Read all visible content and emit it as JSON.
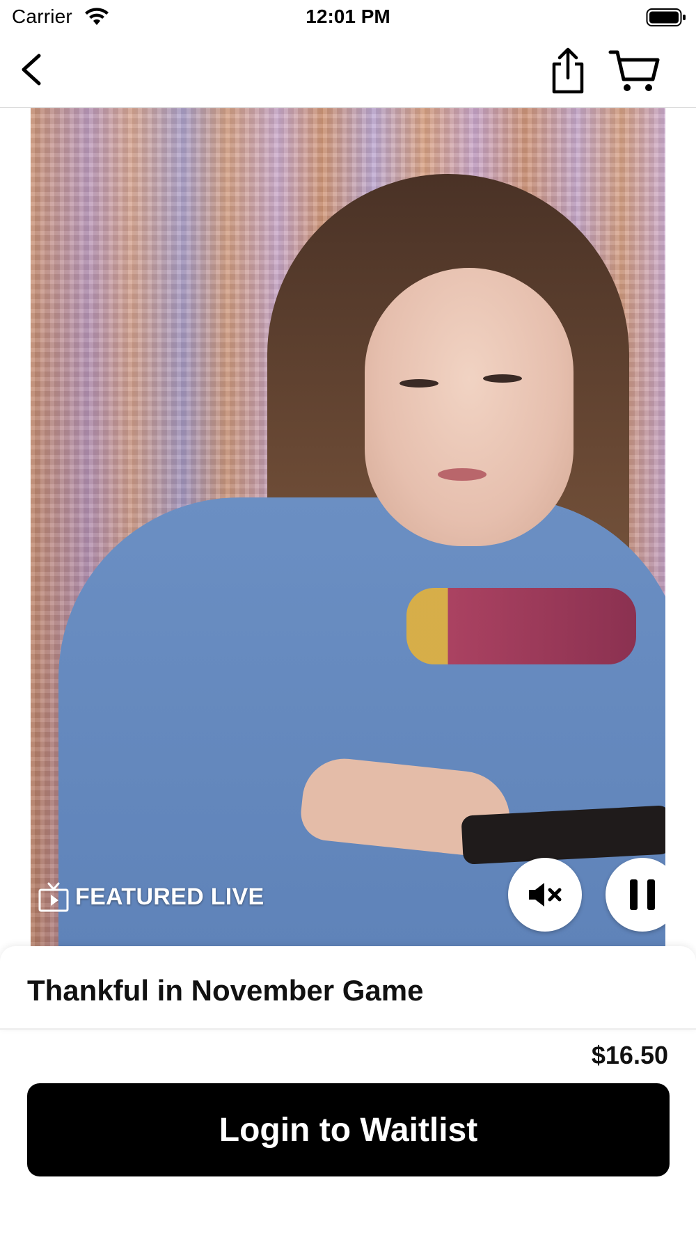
{
  "status_bar": {
    "carrier": "Carrier",
    "time": "12:01 PM",
    "icons": [
      "wifi-icon",
      "battery-icon"
    ]
  },
  "nav": {
    "icons": [
      "chevron-left-icon",
      "share-icon",
      "cart-icon"
    ]
  },
  "video": {
    "badge_label": "FEATURED LIVE",
    "badge_icon": "tv-play-icon",
    "controls": [
      "mute-icon",
      "pause-icon"
    ]
  },
  "product": {
    "title": "Thankful in November Game",
    "price": "$16.50",
    "cta_label": "Login to Waitlist"
  },
  "colors": {
    "cta_background": "#000000",
    "cta_text": "#ffffff",
    "control_background": "#ffffff"
  }
}
